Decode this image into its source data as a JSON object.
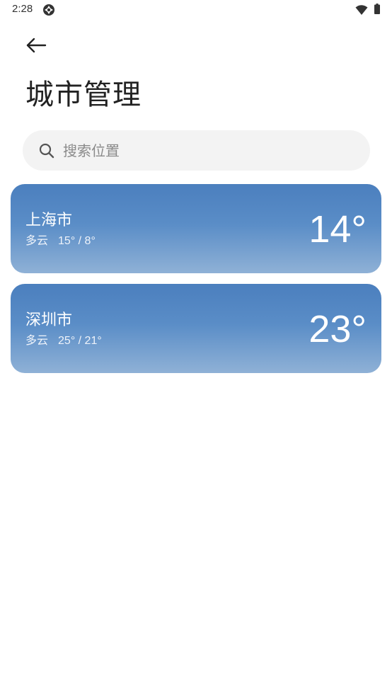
{
  "status_bar": {
    "time": "2:28",
    "app_icon": "aperture-icon",
    "wifi_icon": "wifi-icon",
    "battery_icon": "battery-icon"
  },
  "header": {
    "back_icon": "arrow-left-icon",
    "title": "城市管理"
  },
  "search": {
    "placeholder": "搜索位置",
    "value": ""
  },
  "cities": [
    {
      "name": "上海市",
      "condition": "多云",
      "range": "15° / 8°",
      "temperature": "14°"
    },
    {
      "name": "深圳市",
      "condition": "多云",
      "range": "25° / 21°",
      "temperature": "23°"
    }
  ],
  "colors": {
    "card_top": "#4b7fbe",
    "card_bottom": "#8fb1d6",
    "search_bg": "#f3f3f3"
  }
}
